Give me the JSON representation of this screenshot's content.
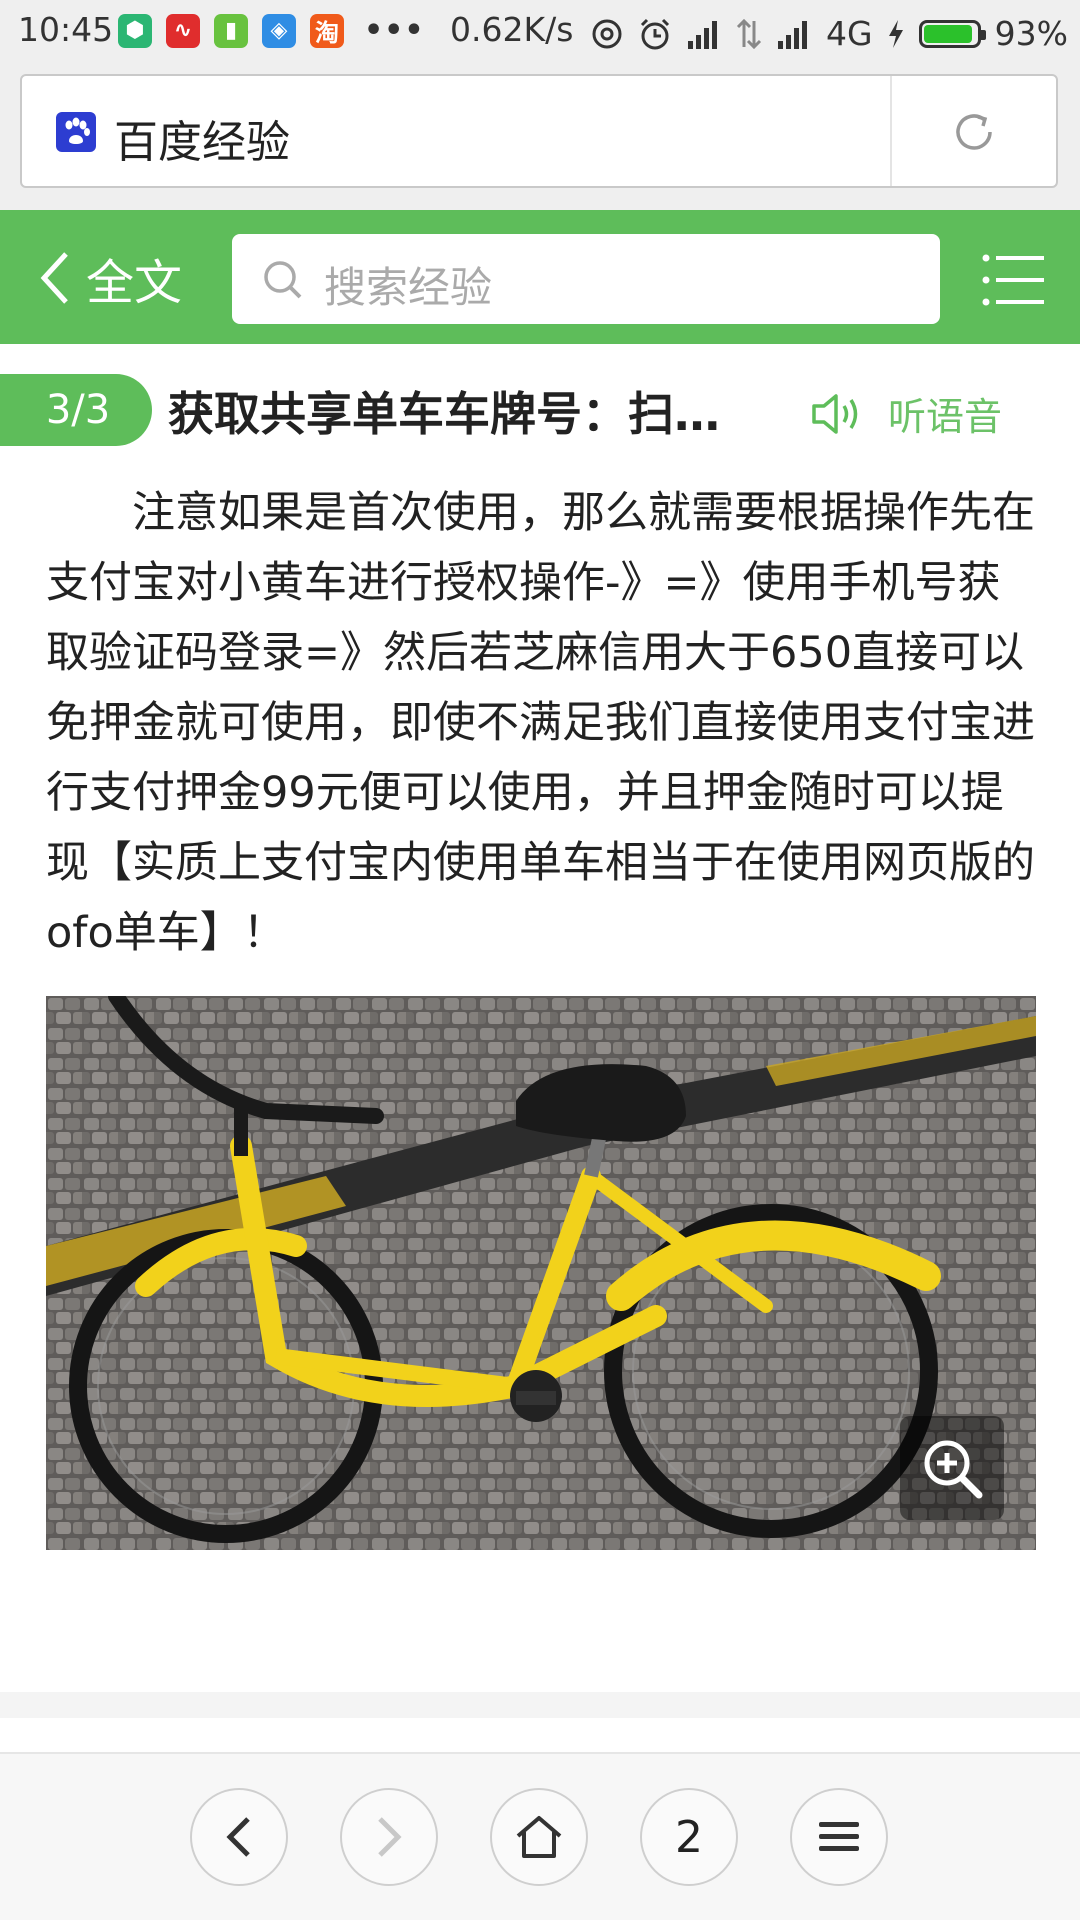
{
  "status_bar": {
    "time": "10:45",
    "app_icons": [
      {
        "name": "shield-app-icon",
        "color": "#2bb673",
        "glyph": "⬢"
      },
      {
        "name": "stock-app-icon",
        "color": "#e02d2d",
        "glyph": "∿"
      },
      {
        "name": "battery-app-icon",
        "color": "#68c23f",
        "glyph": "▮"
      },
      {
        "name": "browser-app-icon",
        "color": "#2f8de4",
        "glyph": "◈"
      },
      {
        "name": "taobao-app-icon",
        "color": "#f05a1a",
        "glyph": "淘"
      }
    ],
    "more": "•••",
    "net_speed": "0.62K/s",
    "network": "4G",
    "battery_percent": "93%",
    "battery_level": 0.93
  },
  "browser": {
    "site_title": "百度经验"
  },
  "header": {
    "back_label": "全文",
    "search_placeholder": "搜索经验"
  },
  "step": {
    "badge": "3/3",
    "title": "获取共享单车车牌号：扫…",
    "listen_label": "听语音"
  },
  "body": {
    "text": "注意如果是首次使用，那么就需要根据操作先在支付宝对小黄车进行授权操作-》=》使用手机号获取验证码登录=》然后若芝麻信用大于650直接可以免押金就可使用，即使不满足我们直接使用支付宝进行支付押金99元便可以使用，并且押金随时可以提现【实质上支付宝内使用单车相当于在使用网页版的ofo单车】！"
  },
  "bottom_nav": {
    "tab_count": "2"
  },
  "colors": {
    "accent_green": "#5ebd5a",
    "bike_yellow": "#f2d21b"
  }
}
